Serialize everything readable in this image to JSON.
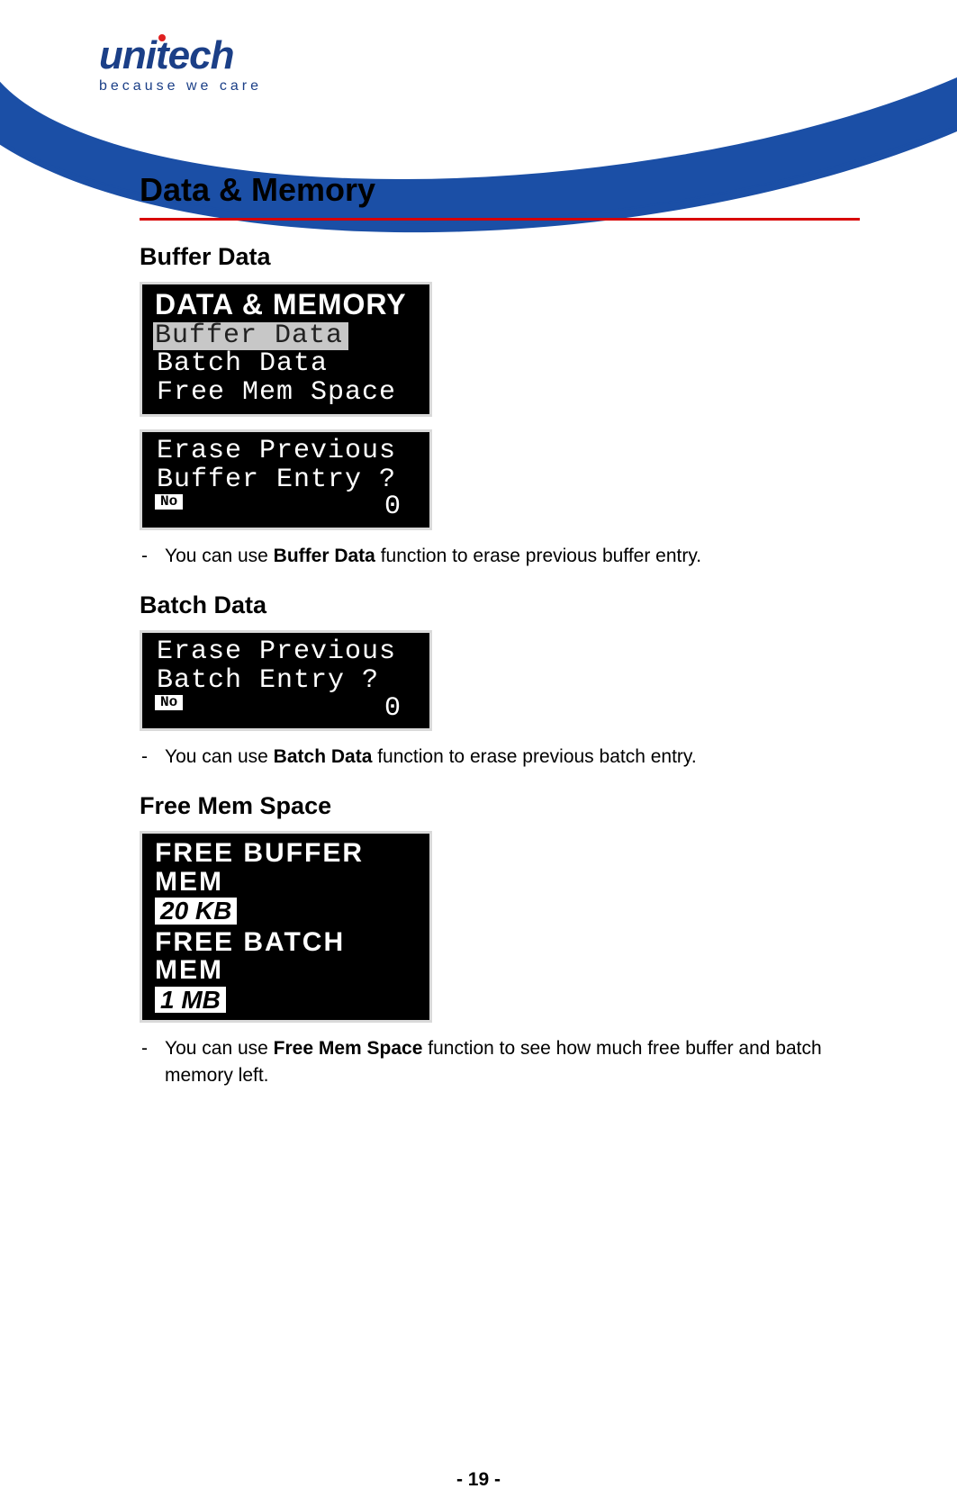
{
  "brand": {
    "name": "unitech",
    "tagline": "because we care"
  },
  "page": {
    "title": "Data & Memory",
    "number": "- 19 -"
  },
  "sections": {
    "buffer": {
      "heading": "Buffer Data",
      "menu_title": "DATA & MEMORY",
      "menu_item_selected": "Buffer Data",
      "menu_item_2": "Batch Data",
      "menu_item_3": "Free Mem Space",
      "prompt_line1": "Erase Previous",
      "prompt_line2": "Buffer Entry ?",
      "prompt_choice": "No",
      "prompt_counter": "0",
      "desc_pre": "You can use ",
      "desc_bold": "Buffer Data",
      "desc_post": " function to erase previous buffer entry."
    },
    "batch": {
      "heading": "Batch Data",
      "prompt_line1": "Erase Previous",
      "prompt_line2": "Batch Entry ?",
      "prompt_choice": "No",
      "prompt_counter": "0",
      "desc_pre": "You can use ",
      "desc_bold": "Batch Data",
      "desc_post": " function to erase previous batch entry."
    },
    "freemem": {
      "heading": "Free Mem Space",
      "label_buffer": "FREE BUFFER MEM",
      "value_buffer": "20 KB",
      "label_batch": "FREE BATCH MEM",
      "value_batch": "1 MB",
      "desc_pre": "You can use ",
      "desc_bold": "Free Mem Space",
      "desc_post": " function to see how much free buffer and batch memory left."
    }
  }
}
